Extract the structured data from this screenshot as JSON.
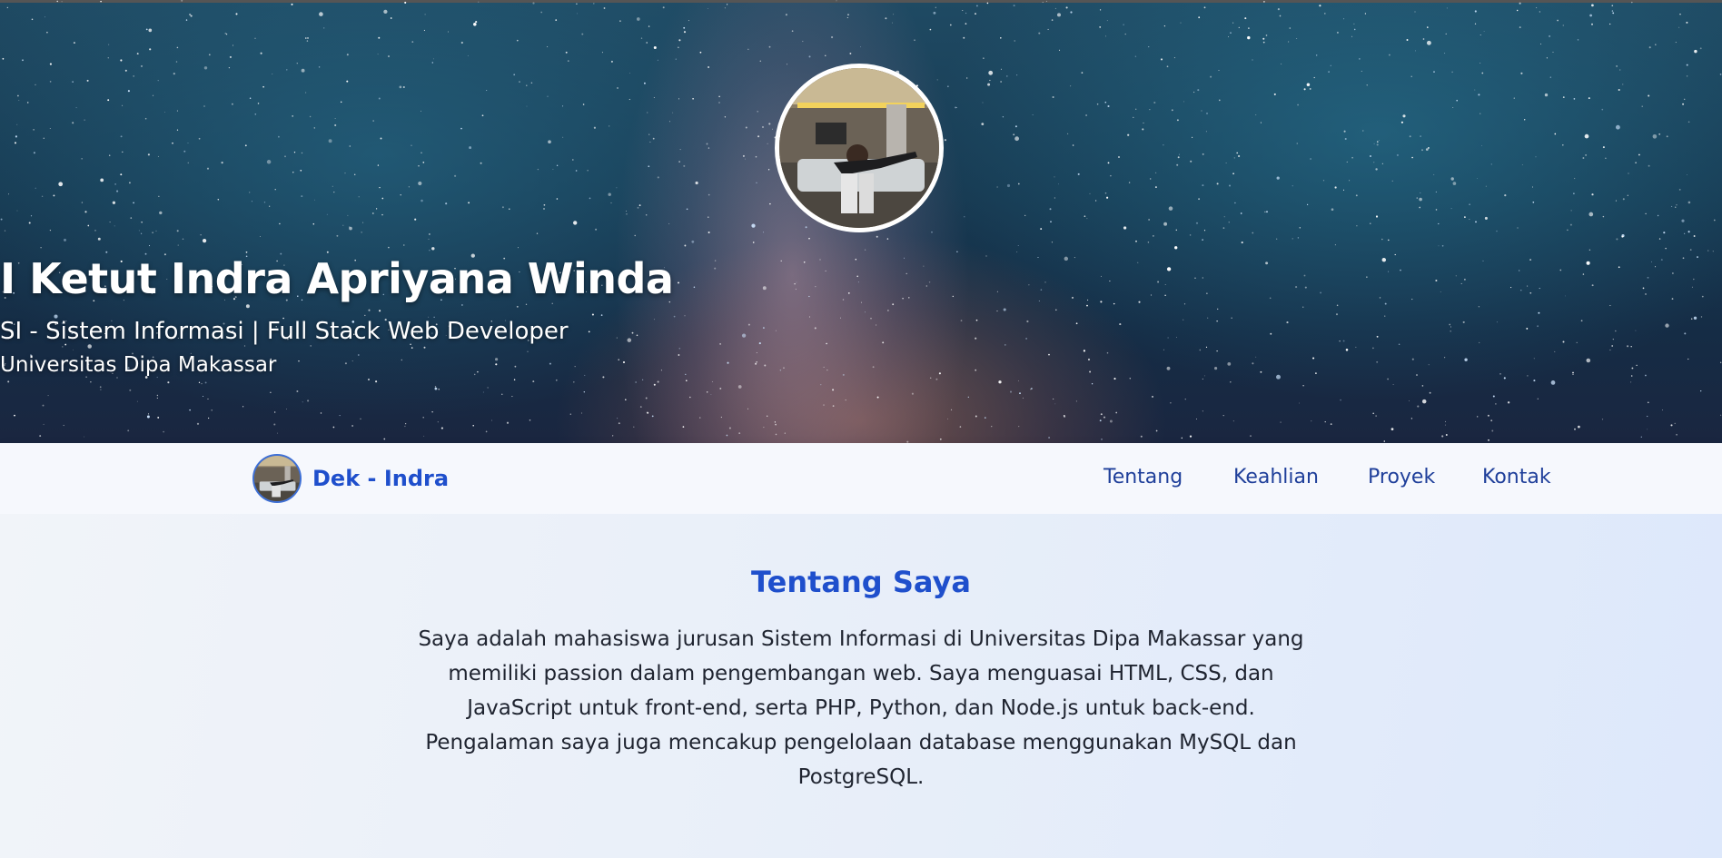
{
  "hero": {
    "name": "I Ketut Indra Apriyana Winda",
    "role": "SI - Sistem Informasi | Full Stack Web Developer",
    "university": "Universitas Dipa Makassar",
    "profile_photo": "profile-photo"
  },
  "navbar": {
    "brand_name": "Dek - Indra",
    "brand_photo": "profile-photo",
    "links": [
      {
        "label": "Tentang"
      },
      {
        "label": "Keahlian"
      },
      {
        "label": "Proyek"
      },
      {
        "label": "Kontak"
      }
    ]
  },
  "about": {
    "title": "Tentang Saya",
    "text": "Saya adalah mahasiswa jurusan Sistem Informasi di Universitas Dipa Makassar yang memiliki passion dalam pengembangan web. Saya menguasai HTML, CSS, dan JavaScript untuk front-end, serta PHP, Python, dan Node.js untuk back-end. Pengalaman saya juga mencakup pengelolaan database menggunakan MySQL dan PostgreSQL."
  },
  "colors": {
    "accent": "#1f4fcc",
    "nav_link": "#1f3f9a",
    "nav_bg": "#f6f8fd"
  }
}
